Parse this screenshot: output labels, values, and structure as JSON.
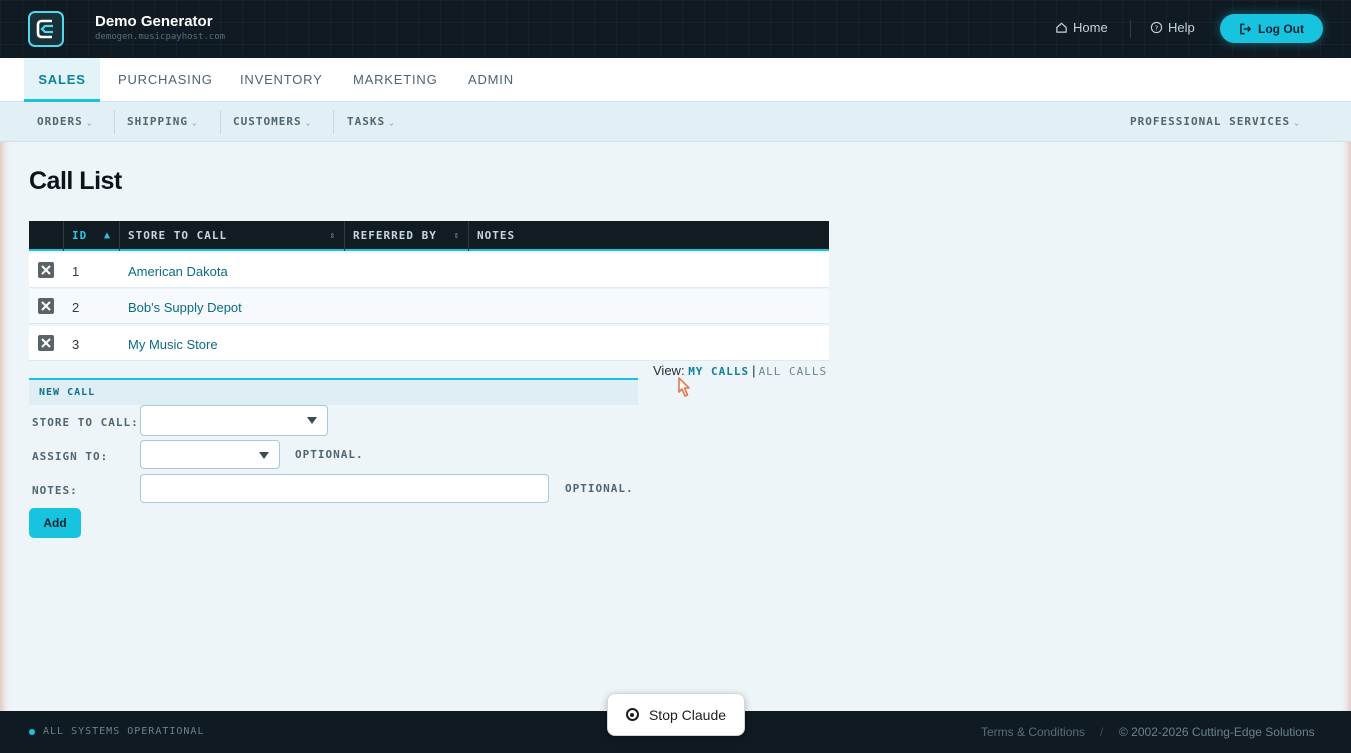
{
  "header": {
    "app_title": "Demo Generator",
    "app_host": "demogen.musicpayhost.com",
    "home_label": "Home",
    "help_label": "Help",
    "logout_label": "Log Out"
  },
  "main_tabs": [
    {
      "label": "SALES",
      "active": true
    },
    {
      "label": "PURCHASING",
      "active": false
    },
    {
      "label": "INVENTORY",
      "active": false
    },
    {
      "label": "MARKETING",
      "active": false
    },
    {
      "label": "ADMIN",
      "active": false
    }
  ],
  "sub_nav": {
    "items": [
      {
        "label": "ORDERS"
      },
      {
        "label": "SHIPPING"
      },
      {
        "label": "CUSTOMERS"
      },
      {
        "label": "TASKS"
      }
    ],
    "right_item": "PROFESSIONAL SERVICES"
  },
  "page_title": "Call List",
  "table": {
    "columns": [
      "ID",
      "STORE TO CALL",
      "REFERRED BY",
      "NOTES"
    ],
    "rows": [
      {
        "id": "1",
        "store": "American Dakota",
        "referred_by": "",
        "notes": ""
      },
      {
        "id": "2",
        "store": "Bob's Supply Depot",
        "referred_by": "",
        "notes": ""
      },
      {
        "id": "3",
        "store": "My Music Store",
        "referred_by": "",
        "notes": ""
      }
    ]
  },
  "view_toggle": {
    "prefix": "View:",
    "my_calls": "MY CALLS",
    "separator": "|",
    "all_calls": "ALL CALLS",
    "selected": "MY CALLS"
  },
  "new_call": {
    "heading": "NEW CALL",
    "store_label": "STORE TO CALL:",
    "store_value": "",
    "assign_label": "ASSIGN TO:",
    "assign_value": "",
    "assign_optional": "OPTIONAL.",
    "notes_label": "NOTES:",
    "notes_value": "",
    "notes_optional": "OPTIONAL.",
    "add_label": "Add"
  },
  "footer": {
    "status": "ALL SYSTEMS OPERATIONAL",
    "terms": "Terms & Conditions",
    "separator": "/",
    "copyright": "© 2002-2026 Cutting-Edge Solutions"
  },
  "overlay": {
    "stop_label": "Stop Claude"
  },
  "colors": {
    "accent": "#18c3e0",
    "dark": "#0f1a22",
    "link": "#0b6a86"
  }
}
